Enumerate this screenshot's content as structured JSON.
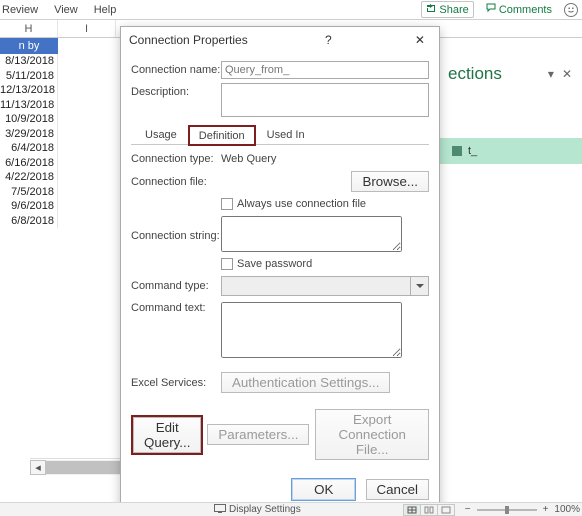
{
  "ribbon": {
    "menus": [
      "Review",
      "View",
      "Help"
    ],
    "share": "Share",
    "comments": "Comments"
  },
  "grid": {
    "columns": [
      "H",
      "I"
    ],
    "header_label": "n by",
    "rows": [
      "8/13/2018",
      "5/11/2018",
      "12/13/2018",
      "11/13/2018",
      "10/9/2018",
      "3/29/2018",
      "6/4/2018",
      "6/16/2018",
      "4/22/2018",
      "7/5/2018",
      "9/6/2018",
      "6/8/2018"
    ]
  },
  "pane": {
    "title": "ections",
    "item_prefix": "t_"
  },
  "dialog": {
    "title": "Connection Properties",
    "help": "?",
    "name_label": "Connection name:",
    "name_value": "Query_from_",
    "desc_label": "Description:",
    "tabs": {
      "usage": "Usage",
      "definition": "Definition",
      "used_in": "Used In"
    },
    "conn_type_label": "Connection type:",
    "conn_type_value": "Web Query",
    "conn_file_label": "Connection file:",
    "browse": "Browse...",
    "always_use": "Always use connection file",
    "conn_string_label": "Connection string:",
    "save_pw": "Save password",
    "cmd_type_label": "Command type:",
    "cmd_text_label": "Command text:",
    "excel_services_label": "Excel Services:",
    "auth_btn": "Authentication Settings...",
    "edit_query": "Edit Query...",
    "parameters": "Parameters...",
    "export": "Export Connection File...",
    "ok": "OK",
    "cancel": "Cancel"
  },
  "status": {
    "display": "Display Settings",
    "zoom_minus": "−",
    "zoom_plus": "+",
    "zoom_pct": "100%"
  }
}
